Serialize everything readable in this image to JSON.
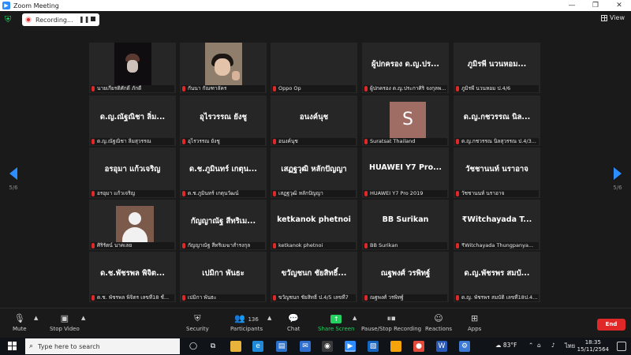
{
  "window": {
    "title": "Zoom Meeting",
    "controls": [
      "—",
      "❐",
      "✕"
    ]
  },
  "topbar": {
    "recording_label": "Recording...",
    "pause_glyph": "❚❚",
    "view_label": "View"
  },
  "pager": {
    "left_label": "5/6",
    "right_label": "5/6"
  },
  "tiles": [
    {
      "big": "",
      "name": "นายเกียรติศักดิ์ ภักดี"
    },
    {
      "big": "",
      "name": "กันนา กัณฑาลัคร"
    },
    {
      "big": "",
      "name": "Oppo Op"
    },
    {
      "big": "ผู้ปกครอง ด.ญ.ปร...",
      "name": "ผู้ปกครอง ด.ญ.ประกาศิริ จงกุลพ..."
    },
    {
      "big": "ภูมิรพี นวนหอม...",
      "name": "ภูมิรพี นวนหอม ป.4/6"
    },
    {
      "big": "ด.ญ.ณัฐณิชา ลิ่ม...",
      "name": "ด.ญ.ณัฐณิชา ลิ่มสุวรรณ"
    },
    {
      "big": "อุไรวรรณ ยังชู",
      "name": "อุไรวรรณ ยังชู"
    },
    {
      "big": "อนงค์นุช",
      "name": "อนงค์นุช"
    },
    {
      "big": "",
      "name": "Suratsat Thailand",
      "avatar": "S"
    },
    {
      "big": "ด.ญ.กชวรรณ นิล...",
      "name": "ด.ญ.กชวรรณ นิลสุวรรณ ป.4/3..."
    },
    {
      "big": "อรอุมา แก้วเจริญ",
      "name": "อรอุมา แก้วเจริญ"
    },
    {
      "big": "ด.ช.ภูมินทร์ เกตุน...",
      "name": "ด.ช.ภูมินทร์ เกตุนวัฒน์"
    },
    {
      "big": "เสฏฐวุฒิ หลักปัญญา",
      "name": "เสฏฐวุฒิ หลักปัญญา"
    },
    {
      "big": "HUAWEI Y7 Pro...",
      "name": "HUAWEI Y7 Pro 2019"
    },
    {
      "big": "วัชชานนท์ นราอาจ",
      "name": "วัชชานนท์ นราอาจ"
    },
    {
      "big": "",
      "name": "ศิริรัตน์ นาคเลย"
    },
    {
      "big": "กัญญาณัฐ สีทริเม...",
      "name": "กัญญาณัฐ สีทริเมฆาสำรงกุล"
    },
    {
      "big": "ketkanok phetnoi",
      "name": "ketkanok phetnoi"
    },
    {
      "big": "BB Surikan",
      "name": "BB Surikan"
    },
    {
      "big": "₹Witchayada T...",
      "name": "₹Witchayada   Thungpanya..."
    },
    {
      "big": "ด.ช.พัชรพล พิจิต...",
      "name": "ด.ช. พัชรพล พิจิตร เลขที่18 ชั้..."
    },
    {
      "big": "เปมิกา พันธะ",
      "name": "เปมิกา พันธะ"
    },
    {
      "big": "ขวัญชนก ชัยสิทธิ์...",
      "name": "ขวัญชนก ชัยสิทธิ์ ป.4/5 เลขที่7"
    },
    {
      "big": "ณฐพงศ์ วรพิทฐ์",
      "name": "ณฐพงศ์ วรพิทฐ์"
    },
    {
      "big": "ด.ญ.พัชรพร สมบั...",
      "name": "ด.ญ. พัชรพร สมบัติ เลขที่18ป.4..."
    }
  ],
  "toolbar": {
    "mute": "Mute",
    "stop_video": "Stop Video",
    "security": "Security",
    "participants": "Participants",
    "participants_count": "136",
    "chat": "Chat",
    "share_screen": "Share Screen",
    "pause_recording": "Pause/Stop Recording",
    "reactions": "Reactions",
    "apps": "Apps",
    "end": "End"
  },
  "taskbar": {
    "search_placeholder": "Type here to search",
    "weather": "83°F",
    "language": "ไทย",
    "time": "18:35",
    "date": "15/11/2564"
  },
  "colors": {
    "accent": "#2d8cff",
    "end": "#e02828",
    "share": "#23d160"
  }
}
